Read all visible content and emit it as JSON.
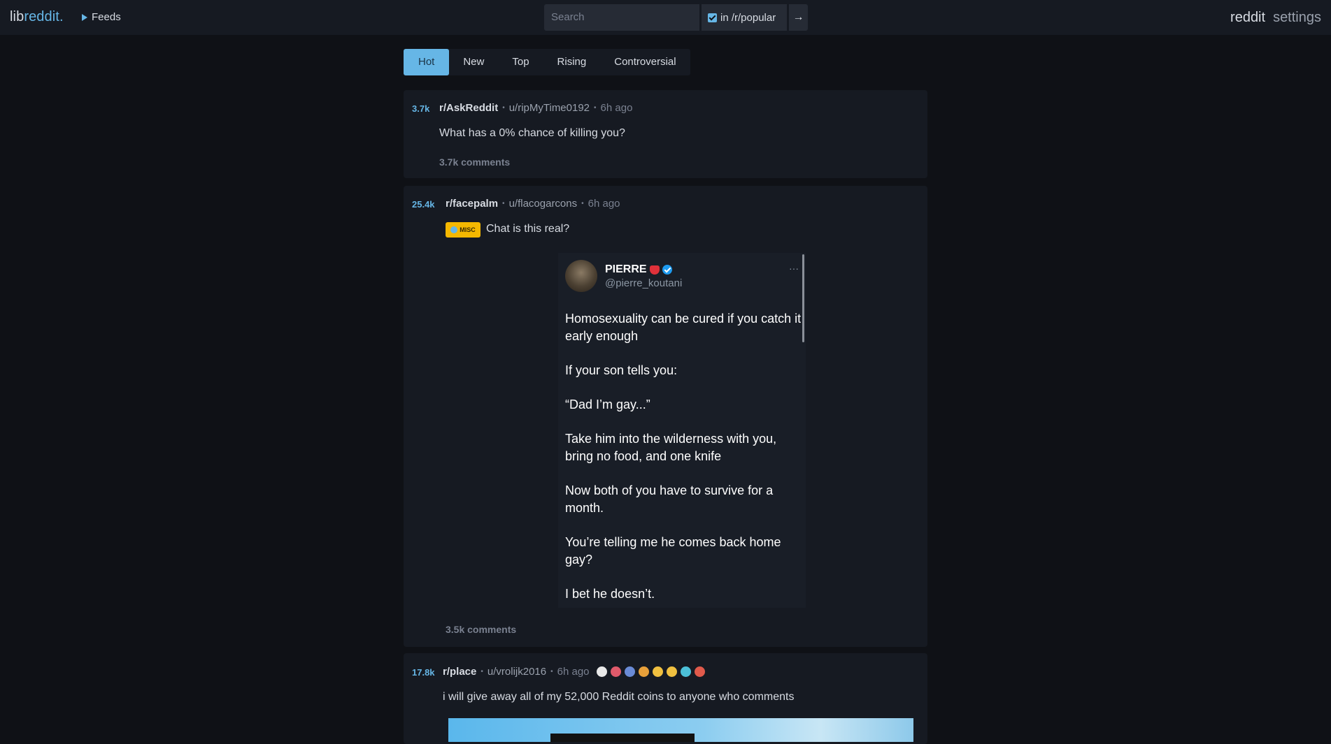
{
  "header": {
    "logo_lib": "lib",
    "logo_reddit": "reddit.",
    "feeds_label": "Feeds",
    "search_placeholder": "Search",
    "scope_label": "in /r/popular",
    "go_symbol": "→",
    "link_reddit": "reddit",
    "link_settings": "settings"
  },
  "sort": {
    "tabs": [
      "Hot",
      "New",
      "Top",
      "Rising",
      "Controversial"
    ],
    "active": "Hot"
  },
  "posts": [
    {
      "score": "3.7k",
      "subreddit": "r/AskReddit",
      "user": "u/ripMyTime0192",
      "time": "6h ago",
      "title": "What has a 0% chance of killing you?",
      "comments": "3.7k comments"
    },
    {
      "score": "25.4k",
      "subreddit": "r/facepalm",
      "user": "u/flacogarcons",
      "time": "6h ago",
      "flair": "MISC",
      "title": "Chat is this real?",
      "comments": "3.5k comments",
      "tweet": {
        "name": "PIERRE",
        "handle": "@pierre_koutani",
        "more": "···",
        "lines": [
          "Homosexuality can be cured if you catch it early enough",
          "If your son tells you:",
          "“Dad I’m gay...”",
          "Take him into the wilderness with you, bring no food, and one knife",
          "Now both of you have to survive for a month.",
          "You’re telling me he comes back home gay?",
          "I bet he doesn’t."
        ]
      }
    },
    {
      "score": "17.8k",
      "subreddit": "r/place",
      "user": "u/vrolijk2016",
      "time": "6h ago",
      "title": "i will give away all of my 52,000 Reddit coins to anyone who comments",
      "award_colors": [
        "#e8e8e8",
        "#e05a6b",
        "#6a8bd6",
        "#e8a03a",
        "#f0c040",
        "#f0c040",
        "#4cc0d8",
        "#e05a4b"
      ]
    }
  ]
}
